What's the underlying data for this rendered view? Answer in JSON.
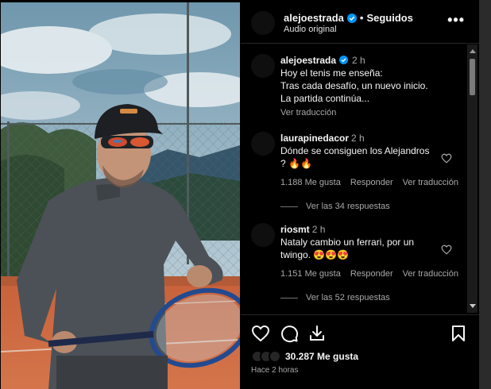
{
  "header": {
    "username": "alejoestrada",
    "separator": "•",
    "follow_status": "Seguidos",
    "audio": "Audio original",
    "more": "•••"
  },
  "caption": {
    "username": "alejoestrada",
    "time": "2 h",
    "lines": [
      "Hoy el tenis me enseña:",
      "Tras cada desafío, un nuevo inicio.",
      "La partida continúa..."
    ],
    "translation_link": "Ver traducción"
  },
  "comments": [
    {
      "username": "laurapinedacor",
      "time": "2 h",
      "lines": [
        "Dónde se consiguen los Alejandros",
        "? 🔥🔥"
      ],
      "likes": "1.188 Me gusta",
      "reply": "Responder",
      "translate": "Ver traducción",
      "replies": "Ver las 34 respuestas"
    },
    {
      "username": "riosmt",
      "time": "2 h",
      "lines": [
        "Nataly cambio un ferrari, por un",
        "twingo. 😍😍😍"
      ],
      "likes": "1.151 Me gusta",
      "reply": "Responder",
      "translate": "Ver traducción",
      "replies": "Ver las 52 respuestas"
    }
  ],
  "footer": {
    "likes": "30.287 Me gusta",
    "time_ago": "Hace 2 horas"
  },
  "icons": {
    "verified": "verified-badge-icon",
    "like": "heart-icon",
    "comment": "comment-icon",
    "share": "share-icon",
    "save": "bookmark-icon",
    "more": "more-options-icon"
  },
  "colors": {
    "background": "#000000",
    "verified": "#0095f6",
    "secondary_text": "#a8a8a8"
  }
}
